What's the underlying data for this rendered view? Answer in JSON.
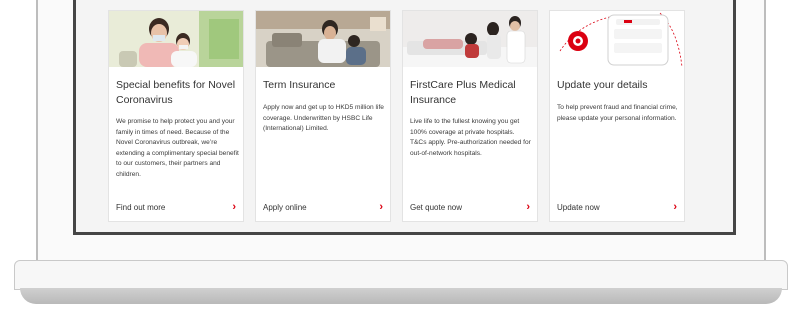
{
  "cards": [
    {
      "title": "Special benefits for Novel Coronavirus",
      "body": "We promise to help protect you and your family in times of need. Because of the Novel Coronavirus outbreak, we’re extending a complimentary special benefit to our customers, their partners and children.",
      "link": "Find out more",
      "image": "family-wearing-masks-photo"
    },
    {
      "title": "Term Insurance",
      "body": "Apply now and get up to HKD5 million life coverage. Underwritten by HSBC Life (International) Limited.",
      "link": "Apply online",
      "image": "father-and-child-on-sofa-photo"
    },
    {
      "title": "FirstCare Plus Medical Insurance",
      "body": "Live life to the fullest knowing you get 100% coverage at private hospitals.\nT&Cs apply. Pre-authorization needed for out-of-network hospitals.",
      "link": "Get quote now",
      "image": "family-in-hospital-photo"
    },
    {
      "title": "Update your details",
      "body": "To help prevent fraud and financial crime, please update your personal information.",
      "link": "Update now",
      "image": "secure-device-illustration"
    }
  ],
  "chevron": "›",
  "colors": {
    "accent": "#db0011",
    "card_bg": "#ffffff",
    "screen_bg": "#f4f4f4"
  }
}
